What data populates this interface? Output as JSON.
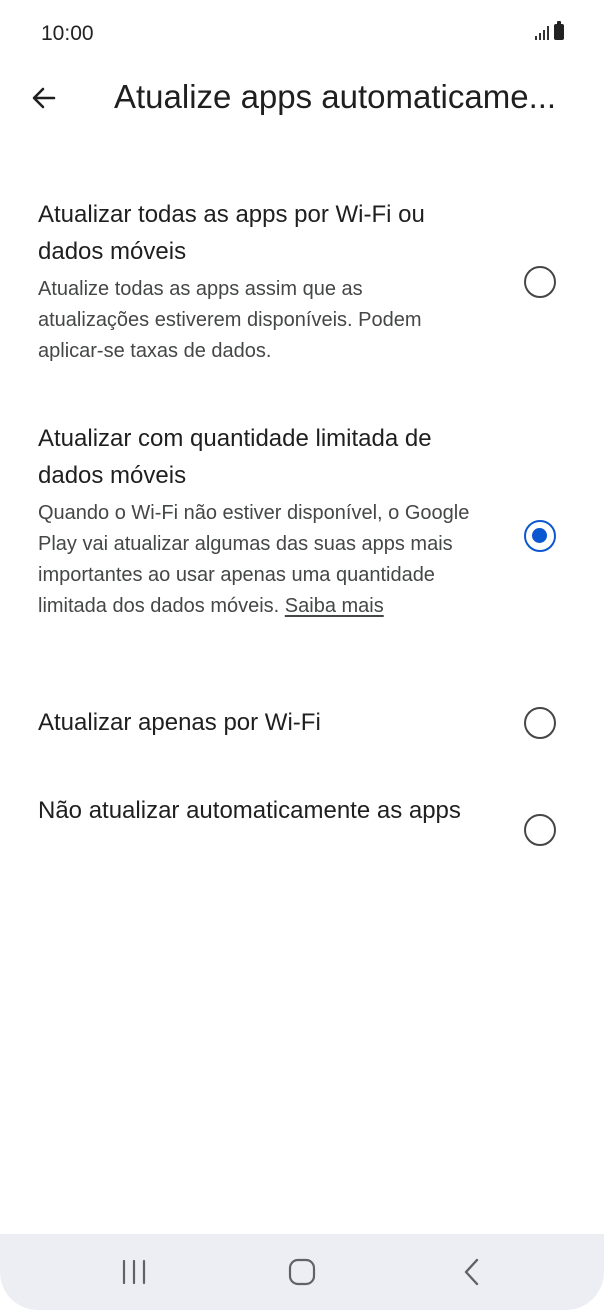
{
  "status_bar": {
    "time": "10:00",
    "icons": [
      "signal-icon",
      "battery-icon"
    ]
  },
  "header": {
    "title": "Atualize apps automaticame..."
  },
  "options": [
    {
      "title": "Atualizar todas as apps por Wi-Fi ou dados móveis",
      "description": "Atualize todas as apps assim que as atualizações estiverem disponíveis. Podem aplicar-se taxas de dados.",
      "selected": false
    },
    {
      "title": "Atualizar com quantidade limitada de dados móveis",
      "description": "Quando o Wi-Fi não estiver disponível, o Google Play vai atualizar algumas das suas apps mais importantes ao usar apenas uma quantidade limitada dos dados móveis.",
      "link": "Saiba mais",
      "selected": true
    },
    {
      "title": "Atualizar apenas por Wi-Fi",
      "selected": false
    },
    {
      "title": "Não atualizar automaticamente as apps",
      "selected": false
    }
  ],
  "nav_bar": {
    "icons": [
      "recents-icon",
      "home-icon",
      "back-icon"
    ]
  },
  "colors": {
    "accent": "#0b57d0",
    "nav_background": "#eceef3"
  }
}
